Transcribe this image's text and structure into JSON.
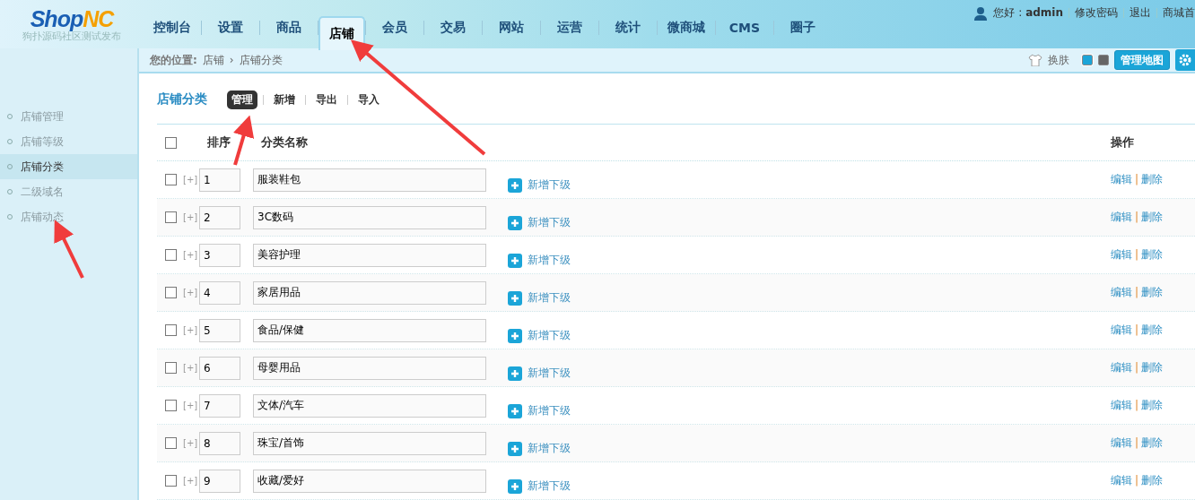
{
  "logo": {
    "primary": "Shop",
    "accent": "NC",
    "subtitle": "狗扑源码社区测试发布"
  },
  "nav": [
    {
      "label": "控制台",
      "selected": false
    },
    {
      "label": "设置",
      "selected": false
    },
    {
      "label": "商品",
      "selected": false
    },
    {
      "label": "店铺",
      "selected": true
    },
    {
      "label": "会员",
      "selected": false
    },
    {
      "label": "交易",
      "selected": false
    },
    {
      "label": "网站",
      "selected": false
    },
    {
      "label": "运营",
      "selected": false
    },
    {
      "label": "统计",
      "selected": false
    },
    {
      "label": "微商城",
      "selected": false
    },
    {
      "label": "CMS",
      "selected": false
    },
    {
      "label": "圈子",
      "selected": false
    }
  ],
  "user_bar": {
    "greeting": "您好 : ",
    "user": "admin",
    "links": [
      "修改密码",
      "退出",
      "商城首"
    ]
  },
  "breadcrumb": {
    "label": "您的位置:",
    "items": [
      "店铺",
      "店铺分类"
    ],
    "separator": "›"
  },
  "toolbar": {
    "skin_label": "换肤",
    "skins": [
      {
        "color": "#1ba5d8",
        "selected": true
      },
      {
        "color": "#666666",
        "selected": false
      }
    ],
    "map_button": "管理地图"
  },
  "sidebar": [
    {
      "label": "店铺管理",
      "selected": false
    },
    {
      "label": "店铺等级",
      "selected": false
    },
    {
      "label": "店铺分类",
      "selected": true
    },
    {
      "label": "二级域名",
      "selected": false
    },
    {
      "label": "店铺动态",
      "selected": false
    }
  ],
  "page_title": "店铺分类",
  "subtabs": [
    {
      "label": "管理",
      "selected": true
    },
    {
      "label": "新增",
      "selected": false
    },
    {
      "label": "导出",
      "selected": false
    },
    {
      "label": "导入",
      "selected": false
    }
  ],
  "table": {
    "columns": [
      "排序",
      "分类名称",
      "操作"
    ],
    "select_all_checked": false,
    "rows": [
      {
        "expand": "[+]",
        "sort": "1",
        "name": "服装鞋包",
        "checked": false,
        "add_child": "新增下级",
        "edit": "编辑",
        "separator": "|",
        "delete": "删除"
      },
      {
        "expand": "[+]",
        "sort": "2",
        "name": "3C数码",
        "checked": false,
        "add_child": "新增下级",
        "edit": "编辑",
        "separator": "|",
        "delete": "删除"
      },
      {
        "expand": "[+]",
        "sort": "3",
        "name": "美容护理",
        "checked": false,
        "add_child": "新增下级",
        "edit": "编辑",
        "separator": "|",
        "delete": "删除"
      },
      {
        "expand": "[+]",
        "sort": "4",
        "name": "家居用品",
        "checked": false,
        "add_child": "新增下级",
        "edit": "编辑",
        "separator": "|",
        "delete": "删除"
      },
      {
        "expand": "[+]",
        "sort": "5",
        "name": "食品/保健",
        "checked": false,
        "add_child": "新增下级",
        "edit": "编辑",
        "separator": "|",
        "delete": "删除"
      },
      {
        "expand": "[+]",
        "sort": "6",
        "name": "母婴用品",
        "checked": false,
        "add_child": "新增下级",
        "edit": "编辑",
        "separator": "|",
        "delete": "删除"
      },
      {
        "expand": "[+]",
        "sort": "7",
        "name": "文体/汽车",
        "checked": false,
        "add_child": "新增下级",
        "edit": "编辑",
        "separator": "|",
        "delete": "删除"
      },
      {
        "expand": "[+]",
        "sort": "8",
        "name": "珠宝/首饰",
        "checked": false,
        "add_child": "新增下级",
        "edit": "编辑",
        "separator": "|",
        "delete": "删除"
      },
      {
        "expand": "[+]",
        "sort": "9",
        "name": "收藏/爱好",
        "checked": false,
        "add_child": "新增下级",
        "edit": "编辑",
        "separator": "|",
        "delete": "删除"
      }
    ]
  },
  "annotations": [
    {
      "kind": "arrow"
    },
    {
      "kind": "arrow"
    },
    {
      "kind": "arrow"
    }
  ]
}
